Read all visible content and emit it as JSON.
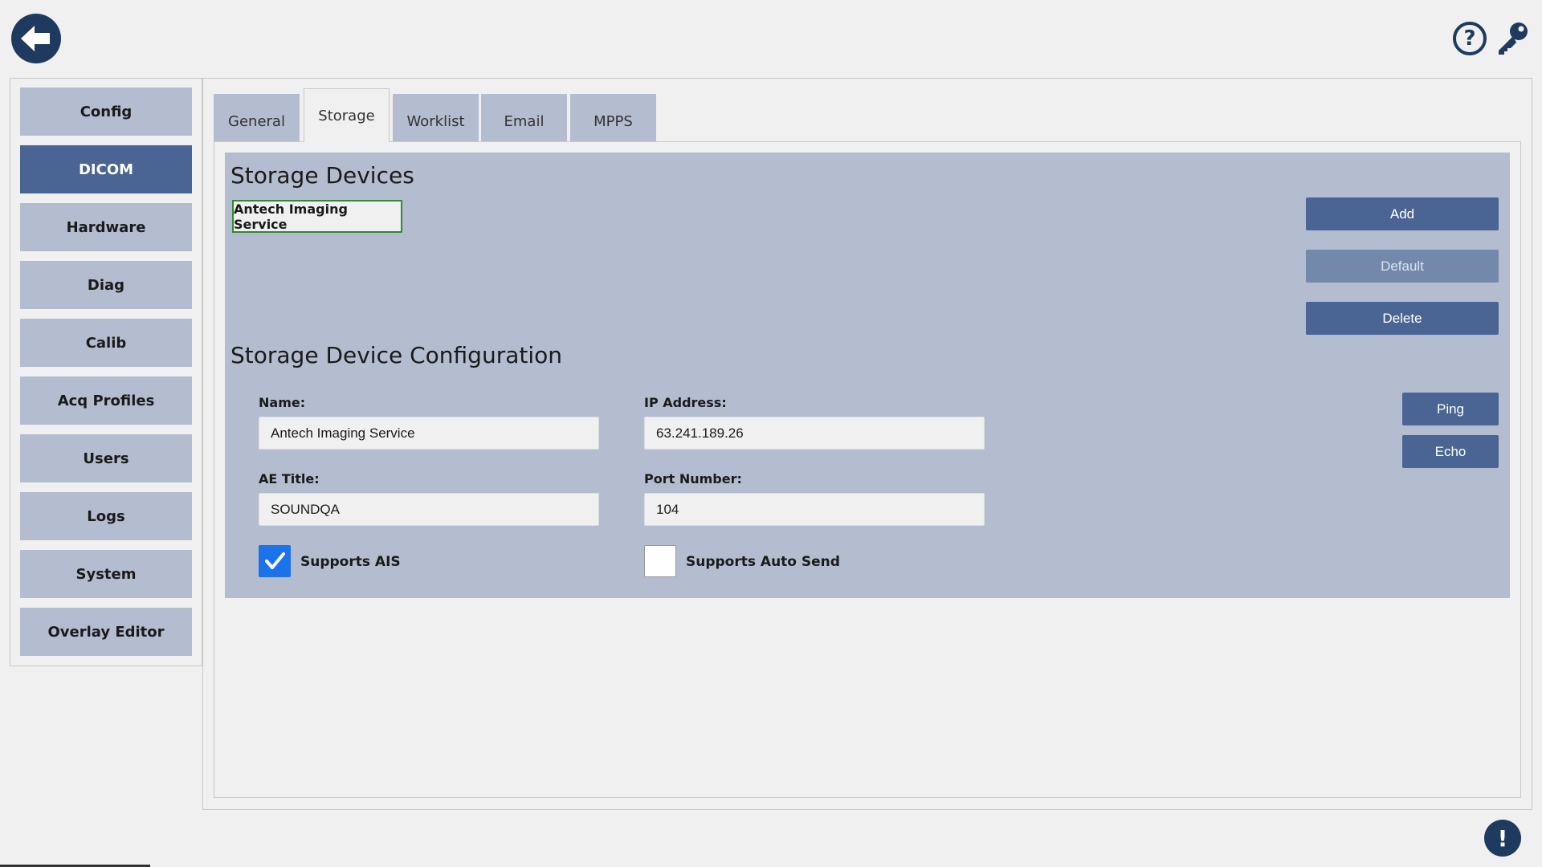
{
  "header": {
    "back_icon": "back-arrow-icon",
    "help_icon": "question-mark-icon",
    "help_glyph": "?",
    "key_icon": "key-icon"
  },
  "sidebar": {
    "items": [
      {
        "label": "Config",
        "active": false
      },
      {
        "label": "DICOM",
        "active": true
      },
      {
        "label": "Hardware",
        "active": false
      },
      {
        "label": "Diag",
        "active": false
      },
      {
        "label": "Calib",
        "active": false
      },
      {
        "label": "Acq Profiles",
        "active": false
      },
      {
        "label": "Users",
        "active": false
      },
      {
        "label": "Logs",
        "active": false
      },
      {
        "label": "System",
        "active": false
      },
      {
        "label": "Overlay Editor",
        "active": false
      }
    ]
  },
  "tabs": [
    {
      "label": "General",
      "active": false
    },
    {
      "label": "Storage",
      "active": true
    },
    {
      "label": "Worklist",
      "active": false
    },
    {
      "label": "Email",
      "active": false
    },
    {
      "label": "MPPS",
      "active": false
    }
  ],
  "storage": {
    "devices_title": "Storage Devices",
    "devices": [
      "Antech Imaging Service"
    ],
    "add_label": "Add",
    "default_label": "Default",
    "delete_label": "Delete",
    "config_title": "Storage Device Configuration",
    "name_label": "Name:",
    "name_value": "Antech Imaging Service",
    "ip_label": "IP Address:",
    "ip_value": "63.241.189.26",
    "ae_label": "AE Title:",
    "ae_value": "SOUNDQA",
    "port_label": "Port Number:",
    "port_value": "104",
    "supports_ais_label": "Supports AIS",
    "supports_ais_checked": true,
    "supports_auto_send_label": "Supports Auto Send",
    "supports_auto_send_checked": false,
    "ping_label": "Ping",
    "echo_label": "Echo"
  },
  "status": {
    "alert_icon": "exclamation-icon",
    "alert_glyph": "!"
  },
  "colors": {
    "accent": "#4a6593",
    "panel": "#b4bccf",
    "icon_navy": "#1e3a5f",
    "checkbox_blue": "#1a73e8",
    "selected_border": "#2e8b2e"
  }
}
